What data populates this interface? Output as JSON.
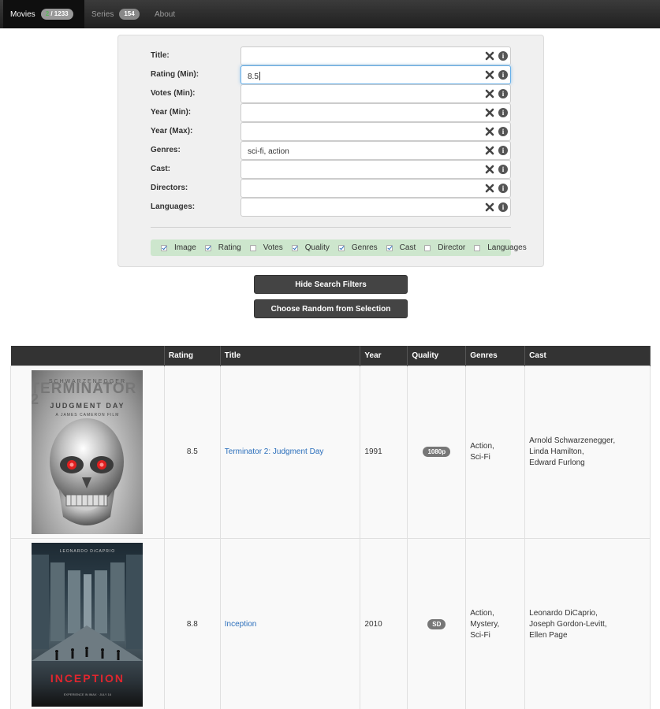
{
  "nav": {
    "movies": {
      "label": "Movies",
      "badge_hl": "2",
      "badge_total": " / 1233"
    },
    "series": {
      "label": "Series",
      "badge": "154"
    },
    "about": {
      "label": "About"
    }
  },
  "filters": [
    {
      "label": "Title:",
      "value": ""
    },
    {
      "label": "Rating (Min):",
      "value": "8.5"
    },
    {
      "label": "Votes (Min):",
      "value": ""
    },
    {
      "label": "Year (Min):",
      "value": ""
    },
    {
      "label": "Year (Max):",
      "value": ""
    },
    {
      "label": "Genres:",
      "value": "sci-fi, action"
    },
    {
      "label": "Cast:",
      "value": ""
    },
    {
      "label": "Directors:",
      "value": ""
    },
    {
      "label": "Languages:",
      "value": ""
    }
  ],
  "columns_toggle": [
    {
      "label": "Image",
      "checked": true
    },
    {
      "label": "Rating",
      "checked": true
    },
    {
      "label": "Votes",
      "checked": false
    },
    {
      "label": "Quality",
      "checked": true
    },
    {
      "label": "Genres",
      "checked": true
    },
    {
      "label": "Cast",
      "checked": true
    },
    {
      "label": "Director",
      "checked": false
    },
    {
      "label": "Languages",
      "checked": false
    }
  ],
  "buttons": {
    "hide_filters": "Hide Search Filters",
    "random": "Choose Random from Selection"
  },
  "table": {
    "headers": [
      "",
      "Rating",
      "Title",
      "Year",
      "Quality",
      "Genres",
      "Cast"
    ],
    "rows": [
      {
        "rating": "8.5",
        "title": "Terminator 2: Judgment Day",
        "year": "1991",
        "quality": "1080p",
        "genres": [
          "Action,",
          "Sci-Fi"
        ],
        "cast": [
          "Arnold Schwarzenegger,",
          "Linda Hamilton,",
          "Edward Furlong"
        ],
        "poster": {
          "top": "SCHWARZENEGGER",
          "big": "TERMINATOR 2",
          "sub": "JUDGMENT DAY",
          "sub2": "A JAMES CAMERON FILM"
        }
      },
      {
        "rating": "8.8",
        "title": "Inception",
        "year": "2010",
        "quality": "SD",
        "genres": [
          "Action,",
          "Mystery,",
          "Sci-Fi"
        ],
        "cast": [
          "Leonardo DiCaprio,",
          "Joseph Gordon-Levitt,",
          "Ellen Page"
        ],
        "poster": {
          "top": "LEONARDO DiCAPRIO",
          "title": "INCEPTION",
          "bot": "EXPERIENCE IN IMAX · JULY 16"
        }
      }
    ]
  },
  "colors": {
    "navbar": "#222222",
    "accent_badge": "#5cb85c",
    "link": "#2a6ebb",
    "column_bar": "#cde6cd"
  },
  "icons": {
    "clear": "times-icon",
    "info": "info-icon"
  }
}
